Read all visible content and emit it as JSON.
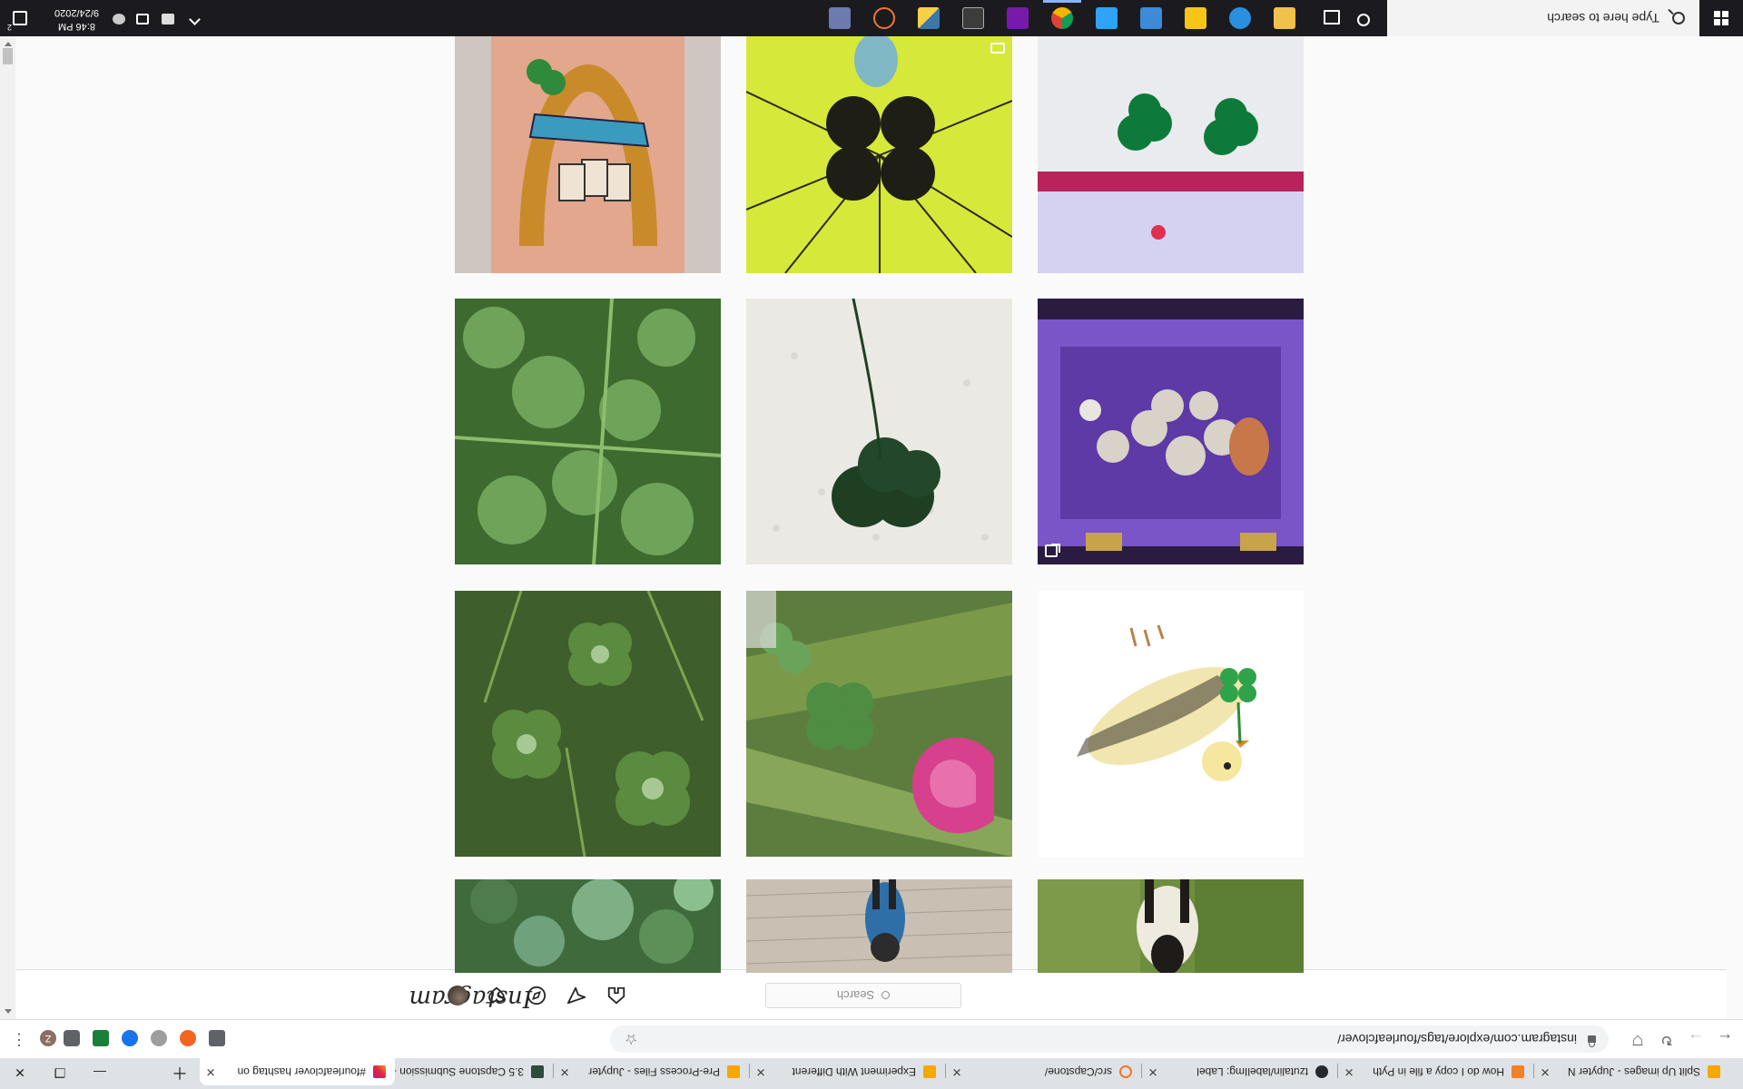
{
  "taskbar": {
    "search_placeholder": "Type here to search",
    "clock_time": "8:46 PM",
    "clock_date": "9/24/2020",
    "notification_count": "2",
    "apps": [
      {
        "name": "cortana-icon",
        "color": "#ffffff"
      },
      {
        "name": "task-view-icon",
        "color": "#ffffff"
      },
      {
        "name": "file-explorer-icon",
        "color": "#f0c14b"
      },
      {
        "name": "edge-icon",
        "color": "#2b8fe0"
      },
      {
        "name": "sticky-app-icon",
        "color": "#f5c518"
      },
      {
        "name": "folder-icon",
        "color": "#e8b84a"
      },
      {
        "name": "photoshop-icon",
        "color": "#2fa3f7"
      },
      {
        "name": "photos-icon",
        "color": "#3a9ad9"
      },
      {
        "name": "chrome-icon",
        "color": "#4caf50"
      },
      {
        "name": "onenote-icon",
        "color": "#7719aa"
      },
      {
        "name": "terminal-icon",
        "color": "#3c3c3c"
      },
      {
        "name": "python-icon",
        "color": "#3b77a8"
      },
      {
        "name": "jupyter-icon",
        "color": "#f37726"
      },
      {
        "name": "calculator-icon",
        "color": "#6c7ab0"
      }
    ]
  },
  "browser": {
    "tabs": [
      {
        "title": "Split Up images - Jupyter N",
        "icon": "jupyter-icon",
        "color": "#f6a700"
      },
      {
        "title": "How do I copy a file in Pyth",
        "icon": "stackoverflow-icon",
        "color": "#f48024"
      },
      {
        "title": "tzutalin/labelImg: Label",
        "icon": "github-icon",
        "color": "#24292e"
      },
      {
        "title": "src/Capstone/",
        "icon": "jupyter-icon",
        "color": "#f37726"
      },
      {
        "title": "Experiment With Different",
        "icon": "jupyter-icon",
        "color": "#f6a700"
      },
      {
        "title": "Pre-Process Files - Jupyter",
        "icon": "jupyter-icon",
        "color": "#f6a700"
      },
      {
        "title": "3.5 Capstone Submission -",
        "icon": "thinkful-icon",
        "color": "#2d4b3a"
      },
      {
        "title": "#fourleafclover hashtag on",
        "icon": "instagram-icon",
        "color": "#c13584"
      }
    ],
    "active_tab_index": 7,
    "url": "instagram.com/explore/tags/fourleafclover/",
    "extensions": [
      {
        "name": "grammarly-icon",
        "color": "#15c39a",
        "label": "G"
      },
      {
        "name": "orange-ext-icon",
        "color": "#f26522",
        "label": ""
      },
      {
        "name": "grey-ext-icon",
        "color": "#5f6368",
        "label": ""
      },
      {
        "name": "blue-ext-icon",
        "color": "#1a73e8",
        "label": ""
      },
      {
        "name": "green-ext-icon",
        "color": "#188038",
        "label": ""
      },
      {
        "name": "puzzle-icon",
        "color": "#5f6368",
        "label": ""
      },
      {
        "name": "profile-avatar",
        "color": "#8d6e63",
        "label": "Z"
      }
    ]
  },
  "instagram": {
    "logo_text": "Instagram",
    "search_placeholder": "Search",
    "nav_icons": [
      "home-icon",
      "direct-icon",
      "explore-icon",
      "activity-icon",
      "profile-avatar"
    ]
  },
  "grid": {
    "rows": [
      [
        "clover-patch-photo",
        "clover-and-pink-flower-photo",
        "bird-with-clover-drawing"
      ],
      [
        "clover-leaves-photo",
        "pressed-clover-photo",
        "crystal-box-photo"
      ],
      [
        "clover-in-grass-photo",
        "clover-stained-glass-photo",
        "pressed-clovers-card-photo"
      ],
      [
        "tattoo-photo",
        "yellow-clover-art-photo",
        "bird-on-lawn-photo"
      ]
    ]
  }
}
